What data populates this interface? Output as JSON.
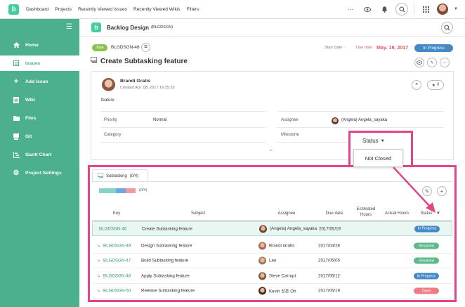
{
  "topnav": {
    "items": [
      "Dashboard",
      "Projects",
      "Recently Viewed Issues",
      "Recently Viewed Wikis",
      "Filters"
    ]
  },
  "logo_letter": "b",
  "sidebar": {
    "items": [
      {
        "label": "Home",
        "icon": "home-icon"
      },
      {
        "label": "Issues",
        "icon": "issues-icon"
      },
      {
        "label": "Add Issue",
        "icon": "plus-icon"
      },
      {
        "label": "Wiki",
        "icon": "wiki-icon"
      },
      {
        "label": "Files",
        "icon": "files-icon"
      },
      {
        "label": "Git",
        "icon": "git-icon"
      },
      {
        "label": "Gantt Chart",
        "icon": "gantt-icon"
      },
      {
        "label": "Project Settings",
        "icon": "gear-icon"
      }
    ],
    "active_index": 1
  },
  "project": {
    "name": "Backlog Design",
    "key": "(BLGDSGN)"
  },
  "issue": {
    "type": "Task",
    "key": "BLGDSGN-46",
    "start_date_label": "Start Date -",
    "due_date_label": "Due date",
    "due_date": "May. 19, 2017",
    "status": "In Progress",
    "title": "Create Subtasking feature",
    "author": "Brandi Gratis",
    "created": "Created  Apr. 08, 2017 16:25:32",
    "description": "feature",
    "star_count": "0",
    "props": {
      "priority_label": "Priority",
      "priority": "Normal",
      "category_label": "Category",
      "assignee_label": "Assignee",
      "assignee": "(Angela) Angela_sayaka",
      "milestone_label": "Milestone"
    }
  },
  "status_popup": {
    "label": "Status",
    "option": "Not Closed"
  },
  "subtasking": {
    "tab_label": "Subtasking",
    "tab_count": "(0/4)",
    "progress_text": "(0/4)",
    "columns": {
      "key": "Key",
      "subject": "Subject",
      "assignee": "Assignee",
      "due": "Due date",
      "estimated": "Estimated Hours",
      "actual": "Actual Hours",
      "status": "Status"
    },
    "rows": [
      {
        "key": "BLGDSGN-46",
        "subject": "Create Subtasking feature",
        "assignee": "(Angela) Angela_sayaka",
        "due": "2017/05/19",
        "status": "In Progress",
        "status_color": "#4488c5",
        "child": false
      },
      {
        "key": "BLGDSGN-49",
        "subject": "Design Subtasking feature",
        "assignee": "Brandi Gratis",
        "due": "2017/04/28",
        "status": "Resolved",
        "status_color": "#5bb98c",
        "child": true
      },
      {
        "key": "BLGDSGN-47",
        "subject": "Build Subtasking feature",
        "assignee": "Leo",
        "due": "2017/05/05",
        "status": "Resolved",
        "status_color": "#5bb98c",
        "child": true
      },
      {
        "key": "BLGDSGN-48",
        "subject": "Apply Subtasking feature",
        "assignee": "Steve Carrupt",
        "due": "2017/05/12",
        "status": "In Progress",
        "status_color": "#4488c5",
        "child": true
      },
      {
        "key": "BLGDSGN-50",
        "subject": "Release Subtasking feature",
        "assignee": "Kevin 성훈 Oh",
        "due": "2017/05/19",
        "status": "Open",
        "status_color": "#ee7c84",
        "child": true
      }
    ]
  },
  "colors": {
    "brand": "#42ce9f",
    "sidebar": "#4caf8e",
    "highlight": "#e0478a"
  }
}
